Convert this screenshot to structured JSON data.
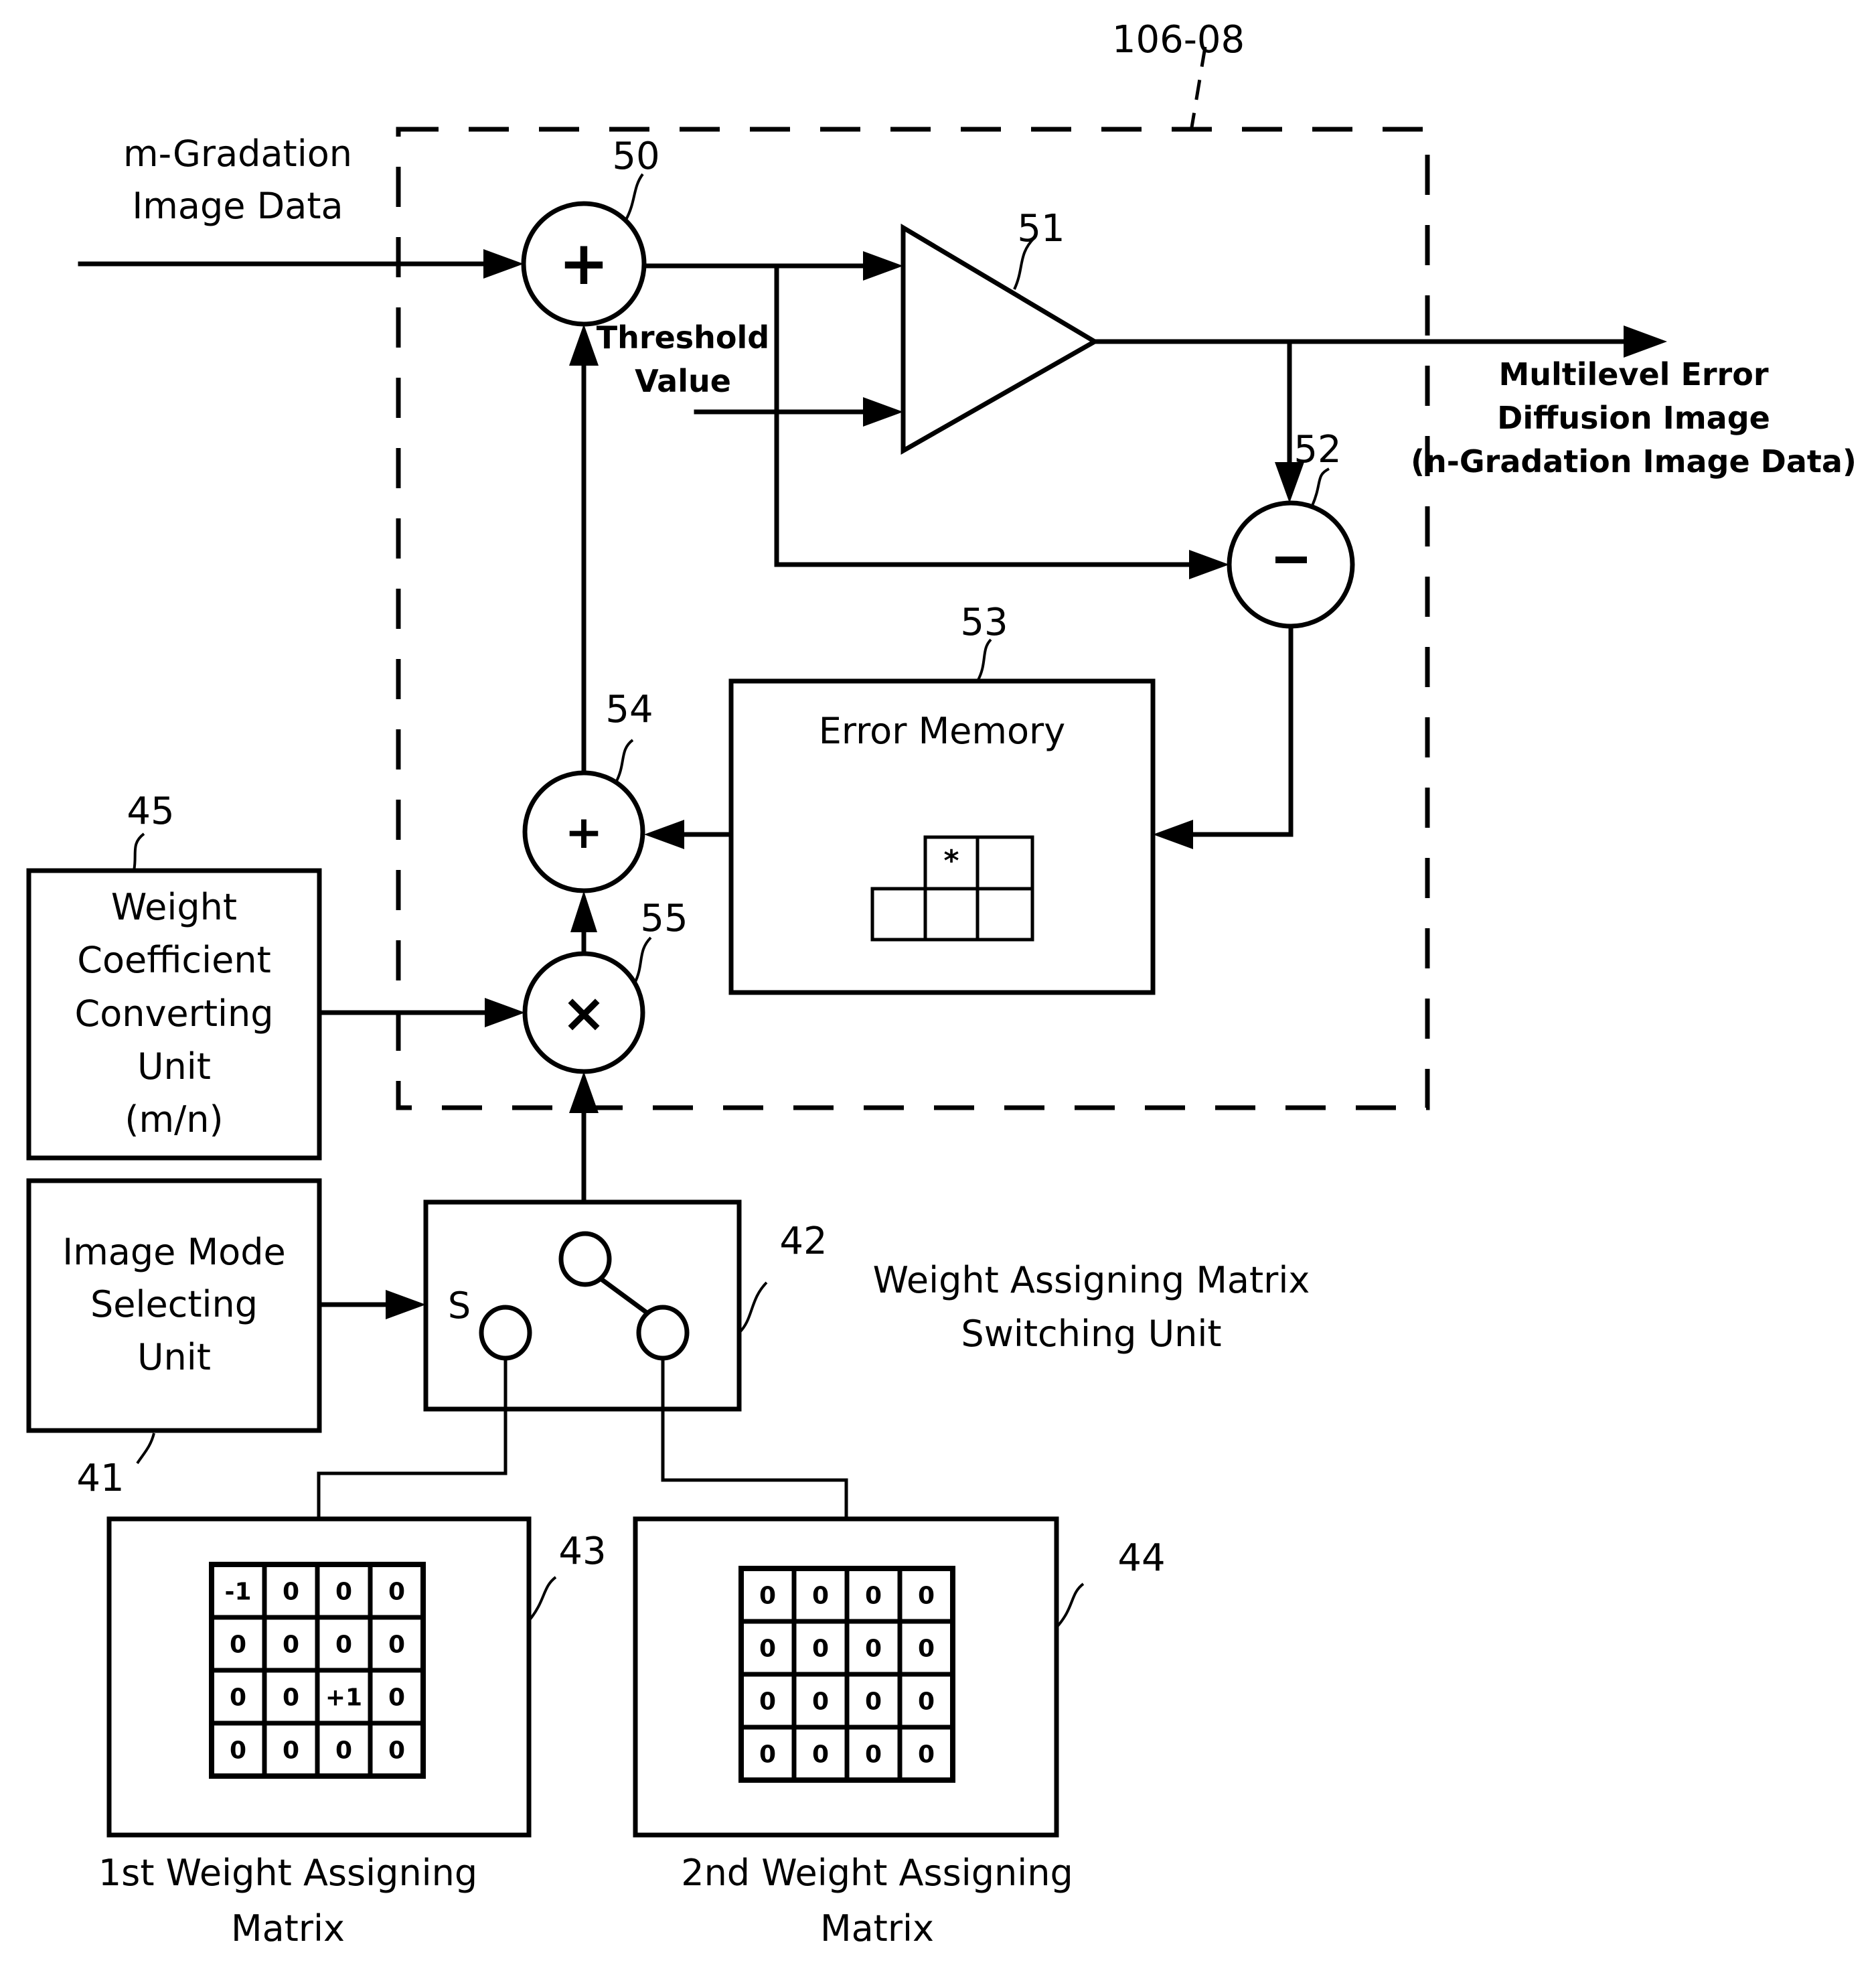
{
  "figure": {
    "module_ref": "106-08",
    "input_label": [
      "m-Gradation",
      "Image Data"
    ],
    "threshold_label": [
      "Threshold",
      "Value"
    ],
    "output_label": [
      "Multilevel Error",
      "Diffusion Image",
      "(n-Gradation Image Data)"
    ],
    "adder_50": {
      "ref": "50",
      "symbol": "+"
    },
    "comparator_51": {
      "ref": "51"
    },
    "subtractor_52": {
      "ref": "52",
      "symbol": "−"
    },
    "error_memory_53": {
      "ref": "53",
      "title": "Error Memory",
      "marker": "*"
    },
    "adder_54": {
      "ref": "54",
      "symbol": "+"
    },
    "multiplier_55": {
      "ref": "55",
      "symbol": "×"
    },
    "weight_converter_45": {
      "ref": "45",
      "lines": [
        "Weight",
        "Coefficient",
        "Converting",
        "Unit",
        "(m/n)"
      ]
    },
    "image_mode_41": {
      "ref": "41",
      "lines": [
        "Image Mode",
        "Selecting",
        "Unit"
      ]
    },
    "switch_42": {
      "ref": "42",
      "terminal_label": "S",
      "caption": [
        "Weight Assigning Matrix",
        "Switching Unit"
      ]
    },
    "matrix_43": {
      "ref": "43",
      "caption": [
        "1st Weight Assigning",
        "Matrix"
      ],
      "cells": [
        [
          "-1",
          "0",
          "0",
          "0"
        ],
        [
          "0",
          "0",
          "0",
          "0"
        ],
        [
          "0",
          "0",
          "+1",
          "0"
        ],
        [
          "0",
          "0",
          "0",
          "0"
        ]
      ]
    },
    "matrix_44": {
      "ref": "44",
      "caption": [
        "2nd Weight Assigning",
        "Matrix"
      ],
      "cells": [
        [
          "0",
          "0",
          "0",
          "0"
        ],
        [
          "0",
          "0",
          "0",
          "0"
        ],
        [
          "0",
          "0",
          "0",
          "0"
        ],
        [
          "0",
          "0",
          "0",
          "0"
        ]
      ]
    }
  }
}
